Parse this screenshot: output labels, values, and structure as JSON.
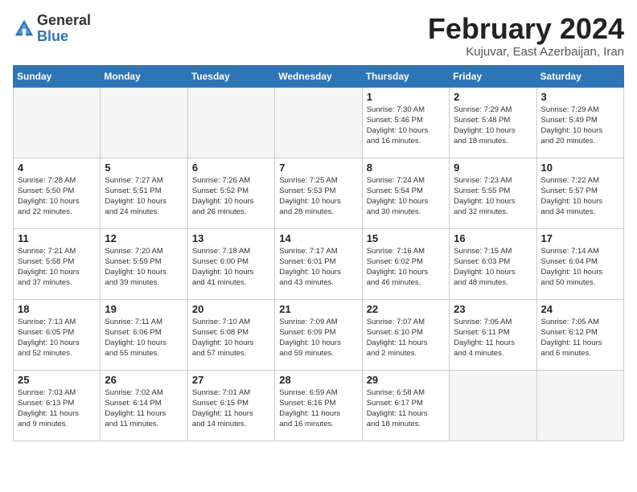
{
  "logo": {
    "general": "General",
    "blue": "Blue"
  },
  "header": {
    "month_year": "February 2024",
    "location": "Kujuvar, East Azerbaijan, Iran"
  },
  "weekdays": [
    "Sunday",
    "Monday",
    "Tuesday",
    "Wednesday",
    "Thursday",
    "Friday",
    "Saturday"
  ],
  "weeks": [
    [
      {
        "day": "",
        "info": ""
      },
      {
        "day": "",
        "info": ""
      },
      {
        "day": "",
        "info": ""
      },
      {
        "day": "",
        "info": ""
      },
      {
        "day": "1",
        "info": "Sunrise: 7:30 AM\nSunset: 5:46 PM\nDaylight: 10 hours\nand 16 minutes."
      },
      {
        "day": "2",
        "info": "Sunrise: 7:29 AM\nSunset: 5:48 PM\nDaylight: 10 hours\nand 18 minutes."
      },
      {
        "day": "3",
        "info": "Sunrise: 7:29 AM\nSunset: 5:49 PM\nDaylight: 10 hours\nand 20 minutes."
      }
    ],
    [
      {
        "day": "4",
        "info": "Sunrise: 7:28 AM\nSunset: 5:50 PM\nDaylight: 10 hours\nand 22 minutes."
      },
      {
        "day": "5",
        "info": "Sunrise: 7:27 AM\nSunset: 5:51 PM\nDaylight: 10 hours\nand 24 minutes."
      },
      {
        "day": "6",
        "info": "Sunrise: 7:26 AM\nSunset: 5:52 PM\nDaylight: 10 hours\nand 26 minutes."
      },
      {
        "day": "7",
        "info": "Sunrise: 7:25 AM\nSunset: 5:53 PM\nDaylight: 10 hours\nand 28 minutes."
      },
      {
        "day": "8",
        "info": "Sunrise: 7:24 AM\nSunset: 5:54 PM\nDaylight: 10 hours\nand 30 minutes."
      },
      {
        "day": "9",
        "info": "Sunrise: 7:23 AM\nSunset: 5:55 PM\nDaylight: 10 hours\nand 32 minutes."
      },
      {
        "day": "10",
        "info": "Sunrise: 7:22 AM\nSunset: 5:57 PM\nDaylight: 10 hours\nand 34 minutes."
      }
    ],
    [
      {
        "day": "11",
        "info": "Sunrise: 7:21 AM\nSunset: 5:58 PM\nDaylight: 10 hours\nand 37 minutes."
      },
      {
        "day": "12",
        "info": "Sunrise: 7:20 AM\nSunset: 5:59 PM\nDaylight: 10 hours\nand 39 minutes."
      },
      {
        "day": "13",
        "info": "Sunrise: 7:18 AM\nSunset: 6:00 PM\nDaylight: 10 hours\nand 41 minutes."
      },
      {
        "day": "14",
        "info": "Sunrise: 7:17 AM\nSunset: 6:01 PM\nDaylight: 10 hours\nand 43 minutes."
      },
      {
        "day": "15",
        "info": "Sunrise: 7:16 AM\nSunset: 6:02 PM\nDaylight: 10 hours\nand 46 minutes."
      },
      {
        "day": "16",
        "info": "Sunrise: 7:15 AM\nSunset: 6:03 PM\nDaylight: 10 hours\nand 48 minutes."
      },
      {
        "day": "17",
        "info": "Sunrise: 7:14 AM\nSunset: 6:04 PM\nDaylight: 10 hours\nand 50 minutes."
      }
    ],
    [
      {
        "day": "18",
        "info": "Sunrise: 7:13 AM\nSunset: 6:05 PM\nDaylight: 10 hours\nand 52 minutes."
      },
      {
        "day": "19",
        "info": "Sunrise: 7:11 AM\nSunset: 6:06 PM\nDaylight: 10 hours\nand 55 minutes."
      },
      {
        "day": "20",
        "info": "Sunrise: 7:10 AM\nSunset: 6:08 PM\nDaylight: 10 hours\nand 57 minutes."
      },
      {
        "day": "21",
        "info": "Sunrise: 7:09 AM\nSunset: 6:09 PM\nDaylight: 10 hours\nand 59 minutes."
      },
      {
        "day": "22",
        "info": "Sunrise: 7:07 AM\nSunset: 6:10 PM\nDaylight: 11 hours\nand 2 minutes."
      },
      {
        "day": "23",
        "info": "Sunrise: 7:06 AM\nSunset: 6:11 PM\nDaylight: 11 hours\nand 4 minutes."
      },
      {
        "day": "24",
        "info": "Sunrise: 7:05 AM\nSunset: 6:12 PM\nDaylight: 11 hours\nand 6 minutes."
      }
    ],
    [
      {
        "day": "25",
        "info": "Sunrise: 7:03 AM\nSunset: 6:13 PM\nDaylight: 11 hours\nand 9 minutes."
      },
      {
        "day": "26",
        "info": "Sunrise: 7:02 AM\nSunset: 6:14 PM\nDaylight: 11 hours\nand 11 minutes."
      },
      {
        "day": "27",
        "info": "Sunrise: 7:01 AM\nSunset: 6:15 PM\nDaylight: 11 hours\nand 14 minutes."
      },
      {
        "day": "28",
        "info": "Sunrise: 6:59 AM\nSunset: 6:16 PM\nDaylight: 11 hours\nand 16 minutes."
      },
      {
        "day": "29",
        "info": "Sunrise: 6:58 AM\nSunset: 6:17 PM\nDaylight: 11 hours\nand 18 minutes."
      },
      {
        "day": "",
        "info": ""
      },
      {
        "day": "",
        "info": ""
      }
    ]
  ]
}
